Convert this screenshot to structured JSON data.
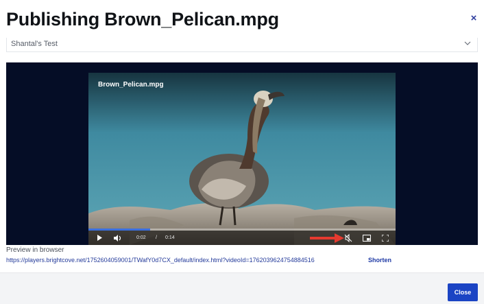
{
  "dialog": {
    "title": "Publishing Brown_Pelican.mpg",
    "close_icon": "×"
  },
  "player_select": {
    "value": "Shantal's Test"
  },
  "video": {
    "title": "Brown_Pelican.mpg",
    "current_time": "0:02",
    "separator": "/",
    "duration": "0:14",
    "progress_fraction": 0.2
  },
  "preview": {
    "label": "Preview in browser",
    "url": "https://players.brightcove.net/1752604059001/TWafY0d7CX_default/index.html?videoId=1762039624754884516",
    "shorten_label": "Shorten"
  },
  "footer": {
    "close_label": "Close"
  },
  "colors": {
    "accent": "#1b44c4",
    "link": "#233a9a",
    "stage_bg": "#050d26",
    "annotation_arrow": "#e53a2f"
  }
}
